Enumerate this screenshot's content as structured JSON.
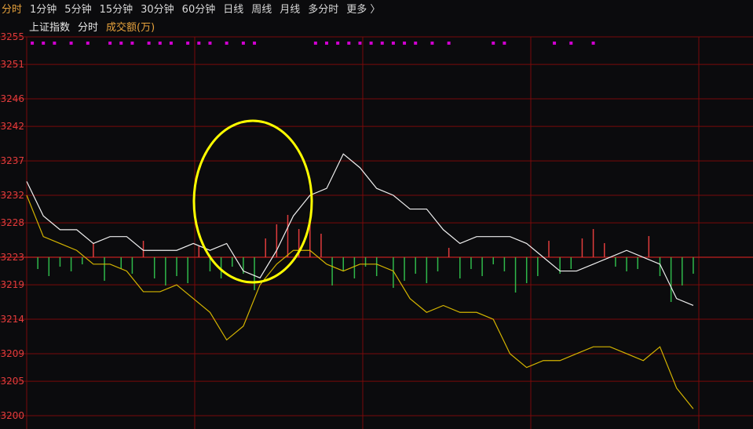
{
  "tabs": [
    {
      "label": "分时",
      "active": true
    },
    {
      "label": "1分钟",
      "active": false
    },
    {
      "label": "5分钟",
      "active": false
    },
    {
      "label": "15分钟",
      "active": false
    },
    {
      "label": "30分钟",
      "active": false
    },
    {
      "label": "60分钟",
      "active": false
    },
    {
      "label": "日线",
      "active": false
    },
    {
      "label": "周线",
      "active": false
    },
    {
      "label": "月线",
      "active": false
    },
    {
      "label": "多分时",
      "active": false
    },
    {
      "label": "更多 〉",
      "active": false
    }
  ],
  "header": {
    "index_name": "上证指数",
    "mode_label": "分时",
    "volume_label": "成交额(万)"
  },
  "colors": {
    "background": "#0b0b0d",
    "grid": "#7a0a0a",
    "axis_label": "#e33d3d",
    "price_line": "#f0f0f0",
    "avg_line": "#d4b400",
    "up_bar": "#e03c3c",
    "down_bar": "#2fb84a",
    "signal_dots": "#d000d0",
    "highlight_ellipse": "#ffff00"
  },
  "chart_data": {
    "type": "line",
    "y_ticks": [
      "3255",
      "3251",
      "3246",
      "3242",
      "3237",
      "3232",
      "3228",
      "3223",
      "3219",
      "3214",
      "3209",
      "3205",
      "3200"
    ],
    "ylim": [
      3200,
      3255
    ],
    "baseline": 3223,
    "x_count": 122,
    "series": [
      {
        "role": "price",
        "x": [
          0,
          3,
          6,
          9,
          12,
          15,
          18,
          21,
          24,
          27,
          30,
          33,
          36,
          39,
          42,
          45,
          48,
          51,
          54,
          57,
          60,
          63,
          66,
          69,
          72,
          75,
          78,
          81,
          84,
          87,
          90,
          93,
          96,
          99,
          102,
          105,
          108,
          111,
          114,
          117,
          120
        ],
        "values": [
          3234,
          3229,
          3227,
          3227,
          3225,
          3226,
          3226,
          3224,
          3224,
          3224,
          3225,
          3224,
          3225,
          3221,
          3220,
          3224,
          3229,
          3232,
          3233,
          3238,
          3236,
          3233,
          3232,
          3230,
          3230,
          3227,
          3225,
          3226,
          3226,
          3226,
          3225,
          3223,
          3221,
          3221,
          3222,
          3223,
          3224,
          3223,
          3222,
          3217,
          3216
        ]
      },
      {
        "role": "average",
        "x": [
          0,
          3,
          6,
          9,
          12,
          15,
          18,
          21,
          24,
          27,
          30,
          33,
          36,
          39,
          42,
          45,
          48,
          51,
          54,
          57,
          60,
          63,
          66,
          69,
          72,
          75,
          78,
          81,
          84,
          87,
          90,
          93,
          96,
          99,
          102,
          105,
          108,
          111,
          114,
          117,
          120
        ],
        "values": [
          3232,
          3226,
          3225,
          3224,
          3222,
          3222,
          3221,
          3218,
          3218,
          3219,
          3217,
          3215,
          3211,
          3213,
          3219,
          3222,
          3224,
          3224,
          3222,
          3221,
          3222,
          3222,
          3221,
          3217,
          3215,
          3216,
          3215,
          3215,
          3214,
          3209,
          3207,
          3208,
          3208,
          3209,
          3210,
          3210,
          3209,
          3208,
          3210,
          3204,
          3201
        ]
      }
    ],
    "volume_bars": [
      {
        "x": 2,
        "v": -5
      },
      {
        "x": 4,
        "v": -8
      },
      {
        "x": 6,
        "v": -4
      },
      {
        "x": 8,
        "v": -6
      },
      {
        "x": 10,
        "v": -3
      },
      {
        "x": 12,
        "v": 6
      },
      {
        "x": 14,
        "v": -10
      },
      {
        "x": 17,
        "v": -5
      },
      {
        "x": 19,
        "v": -7
      },
      {
        "x": 21,
        "v": 7
      },
      {
        "x": 23,
        "v": -9
      },
      {
        "x": 25,
        "v": -12
      },
      {
        "x": 27,
        "v": -8
      },
      {
        "x": 29,
        "v": -11
      },
      {
        "x": 31,
        "v": 5
      },
      {
        "x": 33,
        "v": -6
      },
      {
        "x": 35,
        "v": -9
      },
      {
        "x": 37,
        "v": -4
      },
      {
        "x": 39,
        "v": -7
      },
      {
        "x": 41,
        "v": -14
      },
      {
        "x": 43,
        "v": 8
      },
      {
        "x": 45,
        "v": 14
      },
      {
        "x": 47,
        "v": 18
      },
      {
        "x": 49,
        "v": 12
      },
      {
        "x": 51,
        "v": 16
      },
      {
        "x": 53,
        "v": 10
      },
      {
        "x": 55,
        "v": -12
      },
      {
        "x": 57,
        "v": -6
      },
      {
        "x": 59,
        "v": -9
      },
      {
        "x": 61,
        "v": -4
      },
      {
        "x": 63,
        "v": -8
      },
      {
        "x": 66,
        "v": -13
      },
      {
        "x": 68,
        "v": -10
      },
      {
        "x": 70,
        "v": -7
      },
      {
        "x": 72,
        "v": -11
      },
      {
        "x": 74,
        "v": -6
      },
      {
        "x": 76,
        "v": 4
      },
      {
        "x": 78,
        "v": -9
      },
      {
        "x": 80,
        "v": -5
      },
      {
        "x": 82,
        "v": -8
      },
      {
        "x": 84,
        "v": -3
      },
      {
        "x": 86,
        "v": -6
      },
      {
        "x": 88,
        "v": -15
      },
      {
        "x": 90,
        "v": -11
      },
      {
        "x": 92,
        "v": -8
      },
      {
        "x": 94,
        "v": 7
      },
      {
        "x": 96,
        "v": -7
      },
      {
        "x": 98,
        "v": -5
      },
      {
        "x": 100,
        "v": 8
      },
      {
        "x": 102,
        "v": 12
      },
      {
        "x": 104,
        "v": 6
      },
      {
        "x": 106,
        "v": -4
      },
      {
        "x": 108,
        "v": -6
      },
      {
        "x": 110,
        "v": -5
      },
      {
        "x": 112,
        "v": 9
      },
      {
        "x": 114,
        "v": -8
      },
      {
        "x": 116,
        "v": -19
      },
      {
        "x": 118,
        "v": -12
      },
      {
        "x": 120,
        "v": -7
      }
    ],
    "signal_dot_x": [
      1,
      3,
      5,
      8,
      11,
      15,
      17,
      19,
      22,
      24,
      26,
      29,
      31,
      33,
      36,
      39,
      41,
      52,
      54,
      56,
      58,
      60,
      62,
      64,
      66,
      68,
      70,
      73,
      76,
      84,
      86,
      95,
      98,
      102
    ]
  }
}
